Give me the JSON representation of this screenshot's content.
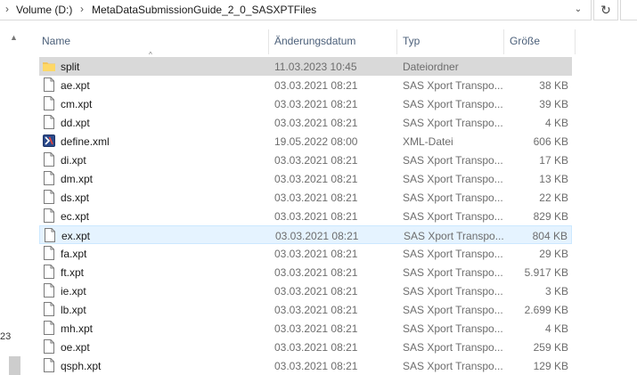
{
  "address_bar": {
    "crumbs": [
      "Volume (D:)",
      "MetaDataSubmissionGuide_2_0_SASXPTFiles"
    ],
    "separator": "›",
    "dropdown_icon": "chevron-down-icon",
    "refresh_icon": "refresh-icon"
  },
  "columns": {
    "name": "Name",
    "date": "Änderungsdatum",
    "type": "Typ",
    "size": "Größe"
  },
  "stray_text": "23",
  "files": [
    {
      "name": "split",
      "date": "11.03.2023 10:45",
      "type": "Dateiordner",
      "size": "",
      "icon": "folder-icon",
      "state": "selected"
    },
    {
      "name": "ae.xpt",
      "date": "03.03.2021 08:21",
      "type": "SAS Xport Transpo...",
      "size": "38 KB",
      "icon": "file-icon",
      "state": ""
    },
    {
      "name": "cm.xpt",
      "date": "03.03.2021 08:21",
      "type": "SAS Xport Transpo...",
      "size": "39 KB",
      "icon": "file-icon",
      "state": ""
    },
    {
      "name": "dd.xpt",
      "date": "03.03.2021 08:21",
      "type": "SAS Xport Transpo...",
      "size": "4 KB",
      "icon": "file-icon",
      "state": ""
    },
    {
      "name": "define.xml",
      "date": "19.05.2022 08:00",
      "type": "XML-Datei",
      "size": "606 KB",
      "icon": "xml-file-icon",
      "state": ""
    },
    {
      "name": "di.xpt",
      "date": "03.03.2021 08:21",
      "type": "SAS Xport Transpo...",
      "size": "17 KB",
      "icon": "file-icon",
      "state": ""
    },
    {
      "name": "dm.xpt",
      "date": "03.03.2021 08:21",
      "type": "SAS Xport Transpo...",
      "size": "13 KB",
      "icon": "file-icon",
      "state": ""
    },
    {
      "name": "ds.xpt",
      "date": "03.03.2021 08:21",
      "type": "SAS Xport Transpo...",
      "size": "22 KB",
      "icon": "file-icon",
      "state": ""
    },
    {
      "name": "ec.xpt",
      "date": "03.03.2021 08:21",
      "type": "SAS Xport Transpo...",
      "size": "829 KB",
      "icon": "file-icon",
      "state": ""
    },
    {
      "name": "ex.xpt",
      "date": "03.03.2021 08:21",
      "type": "SAS Xport Transpo...",
      "size": "804 KB",
      "icon": "file-icon",
      "state": "hover"
    },
    {
      "name": "fa.xpt",
      "date": "03.03.2021 08:21",
      "type": "SAS Xport Transpo...",
      "size": "29 KB",
      "icon": "file-icon",
      "state": ""
    },
    {
      "name": "ft.xpt",
      "date": "03.03.2021 08:21",
      "type": "SAS Xport Transpo...",
      "size": "5.917 KB",
      "icon": "file-icon",
      "state": ""
    },
    {
      "name": "ie.xpt",
      "date": "03.03.2021 08:21",
      "type": "SAS Xport Transpo...",
      "size": "3 KB",
      "icon": "file-icon",
      "state": ""
    },
    {
      "name": "lb.xpt",
      "date": "03.03.2021 08:21",
      "type": "SAS Xport Transpo...",
      "size": "2.699 KB",
      "icon": "file-icon",
      "state": ""
    },
    {
      "name": "mh.xpt",
      "date": "03.03.2021 08:21",
      "type": "SAS Xport Transpo...",
      "size": "4 KB",
      "icon": "file-icon",
      "state": ""
    },
    {
      "name": "oe.xpt",
      "date": "03.03.2021 08:21",
      "type": "SAS Xport Transpo...",
      "size": "259 KB",
      "icon": "file-icon",
      "state": ""
    },
    {
      "name": "qsph.xpt",
      "date": "03.03.2021 08:21",
      "type": "SAS Xport Transpo...",
      "size": "129 KB",
      "icon": "file-icon",
      "state": ""
    }
  ]
}
